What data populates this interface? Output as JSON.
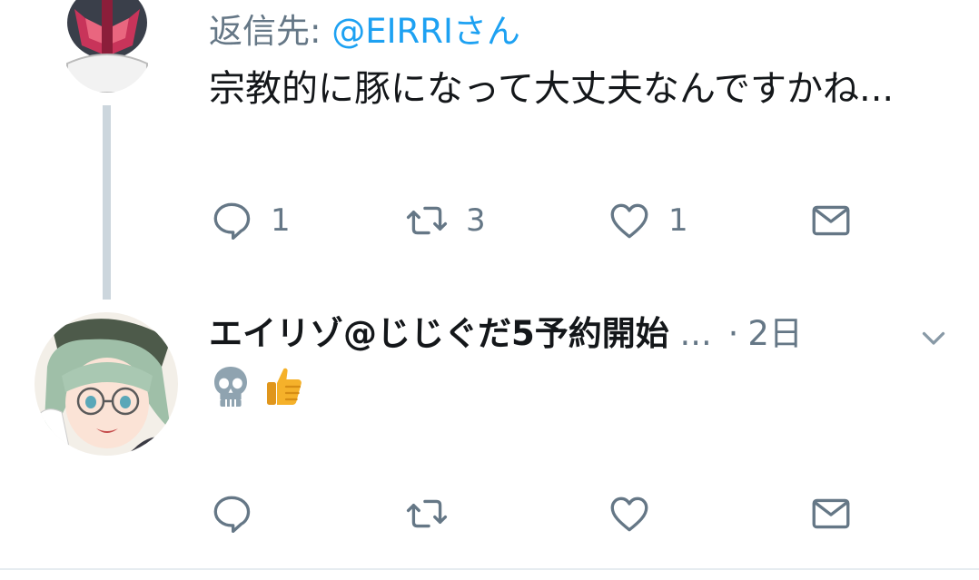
{
  "tweet1": {
    "reply_prefix": "返信先: ",
    "reply_mention": "@EIRRIさん",
    "text": "宗教的に豚になって大丈夫なんですかね...",
    "reply_count": "1",
    "retweet_count": "3",
    "like_count": "1"
  },
  "tweet2": {
    "display_name": "エイリゾ@じじぐだ5予約開始",
    "handle_truncated": "...",
    "separator": "·",
    "time": "2日",
    "emojis": [
      "skull-emoji",
      "thumbs-up-emoji"
    ]
  },
  "colors": {
    "text": "#14171a",
    "secondary": "#657786",
    "link": "#1da1f2",
    "thread_line": "#ccd6dd",
    "icon": "#657786"
  },
  "icons": [
    "reply-icon",
    "retweet-icon",
    "like-icon",
    "direct-message-icon",
    "caret-down-icon"
  ]
}
